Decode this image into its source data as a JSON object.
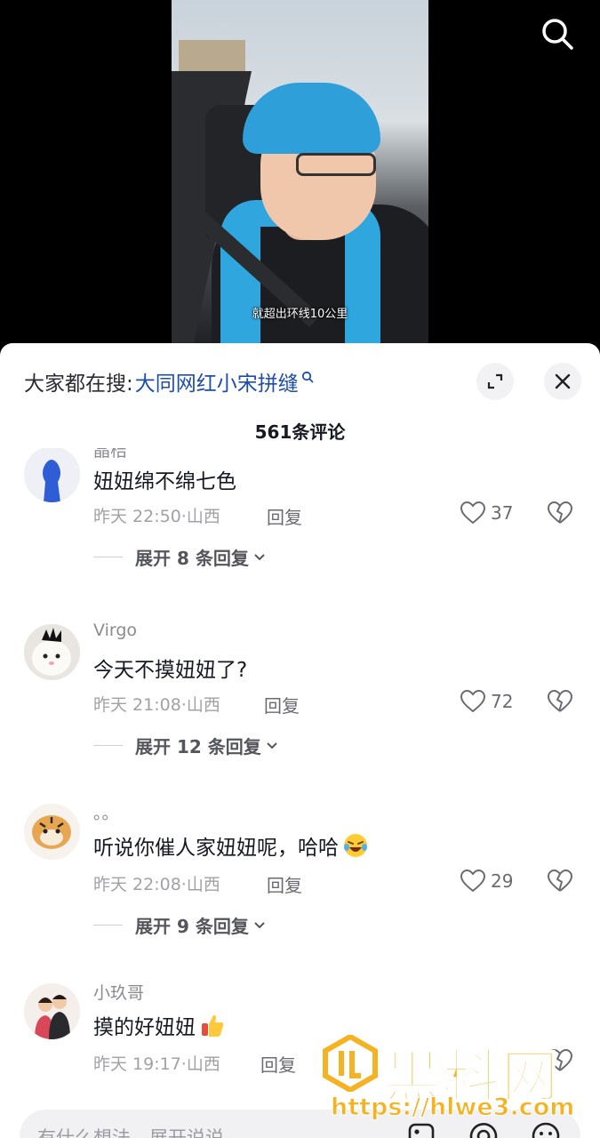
{
  "video": {
    "subtitle": "就超出环线10公里"
  },
  "sheet": {
    "trending_prefix": "大家都在搜:",
    "trending_query": "大同网红小宋拼缝",
    "comment_count": "561条评论"
  },
  "comments": [
    {
      "username": "晶桔",
      "text": "妞妞绵不绵七色",
      "time": "昨天 22:50",
      "location": "山西",
      "reply_label": "回复",
      "likes": "37",
      "expand_label": "展开 8 条回复"
    },
    {
      "username": "Virgo",
      "text": "今天不摸妞妞了?",
      "time": "昨天 21:08",
      "location": "山西",
      "reply_label": "回复",
      "likes": "72",
      "expand_label": "展开 12 条回复"
    },
    {
      "username": "。。",
      "text": "听说你催人家妞妞呢，哈哈",
      "emoji": "laughing-crying-emoji",
      "time": "昨天 22:08",
      "location": "山西",
      "reply_label": "回复",
      "likes": "29",
      "expand_label": "展开 9 条回复"
    },
    {
      "username": "小玖哥",
      "text": "摸的好妞妞",
      "emoji": "thumbs-up-emoji",
      "time": "昨天 19:17",
      "location": "山西",
      "reply_label": "回复",
      "likes": "",
      "expand_label": ""
    }
  ],
  "input": {
    "placeholder": "有什么想法，展开说说"
  },
  "watermark": {
    "title": "黑料网",
    "url": "https://hlwe3.com"
  },
  "colors": {
    "accent_link": "#1f4ea8",
    "helmet_blue": "#2e9fd8",
    "watermark": "#f5b324"
  }
}
